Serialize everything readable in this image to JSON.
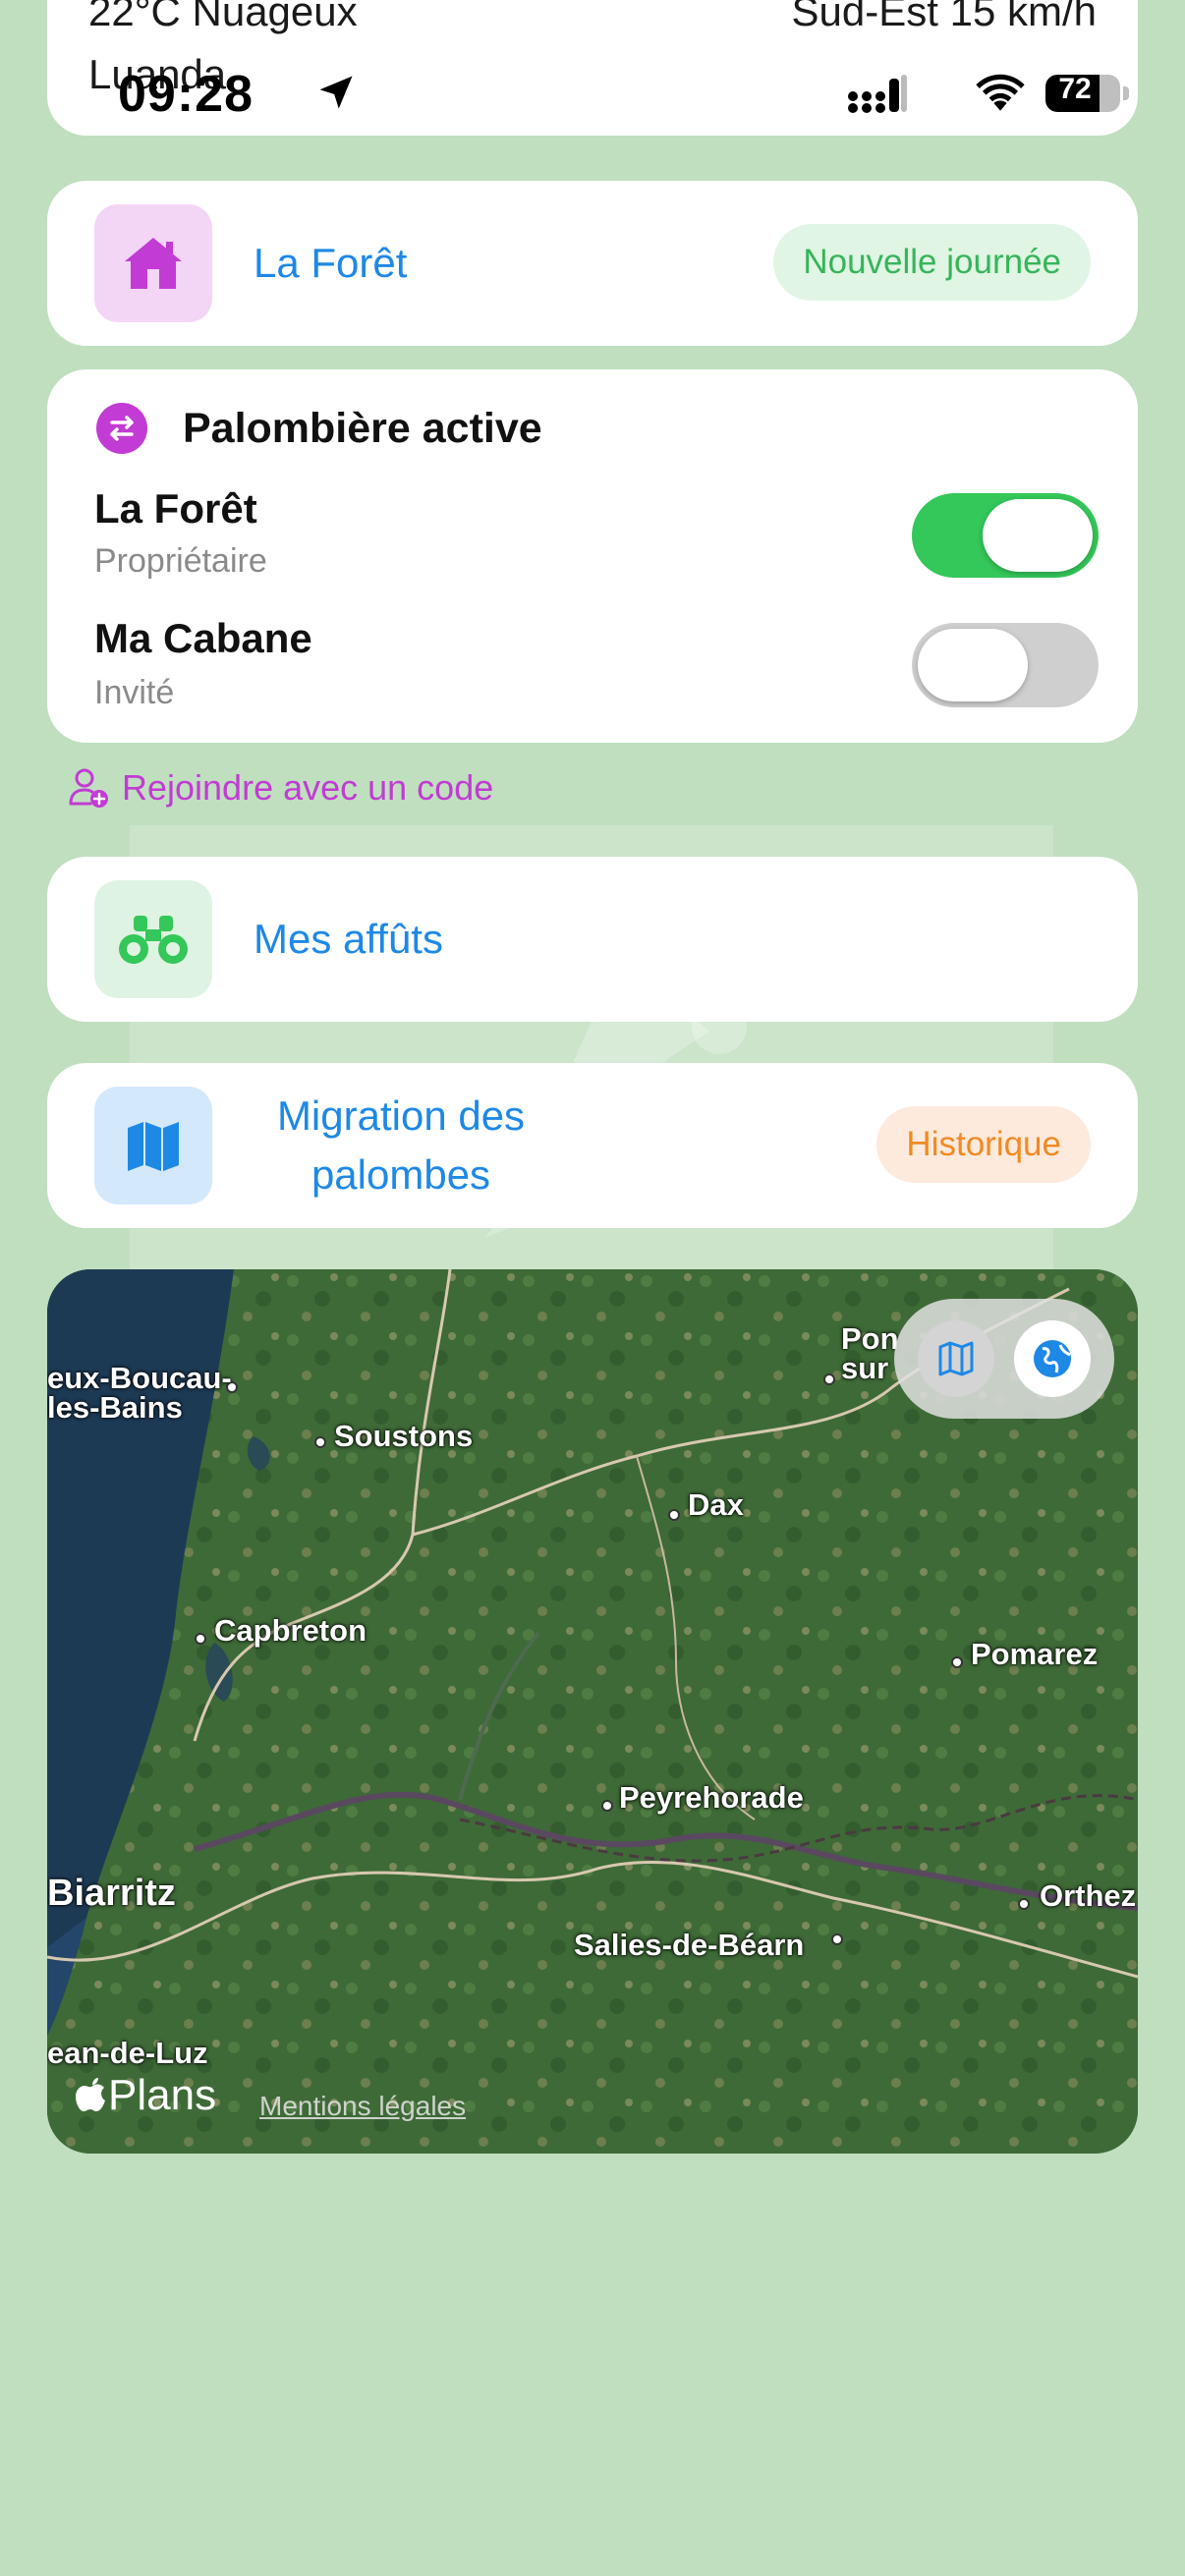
{
  "status": {
    "weather_left": "22°C  Nuageux",
    "weather_right": "Sud-Est 15 km/h",
    "location": "Luanda",
    "time": "09:28",
    "battery": "72",
    "battery_level": 0.72
  },
  "home": {
    "title": "La Forêt",
    "pill": "Nouvelle journée",
    "icon": "house-icon",
    "color": "#c23bd4"
  },
  "active": {
    "title": "Palombière active",
    "icon": "swap-arrows-icon",
    "items": [
      {
        "name": "La Forêt",
        "role": "Propriétaire",
        "enabled": true
      },
      {
        "name": "Ma Cabane",
        "role": "Invité",
        "enabled": false
      }
    ]
  },
  "join": {
    "label": "Rejoindre avec un code",
    "icon": "person-add-icon"
  },
  "affuts": {
    "title": "Mes affûts",
    "icon": "binoculars-icon",
    "color": "#34c759"
  },
  "migration": {
    "title": "Migration des palombes",
    "pill": "Historique",
    "icon": "map-icon",
    "color": "#1e88e5"
  },
  "map": {
    "places": [
      "Soustons",
      "Dax",
      "Capbreton",
      "Pomarez",
      "Peyrehorade",
      "Biarritz",
      "Salies-de-Béarn",
      "Orthez",
      "ean-de-Luz",
      "eux-Boucau-\nles-Bains",
      "Pon\nsur"
    ],
    "brand": "Plans",
    "legal": "Mentions légales",
    "controls": [
      "map-mode-icon",
      "globe-icon"
    ]
  }
}
